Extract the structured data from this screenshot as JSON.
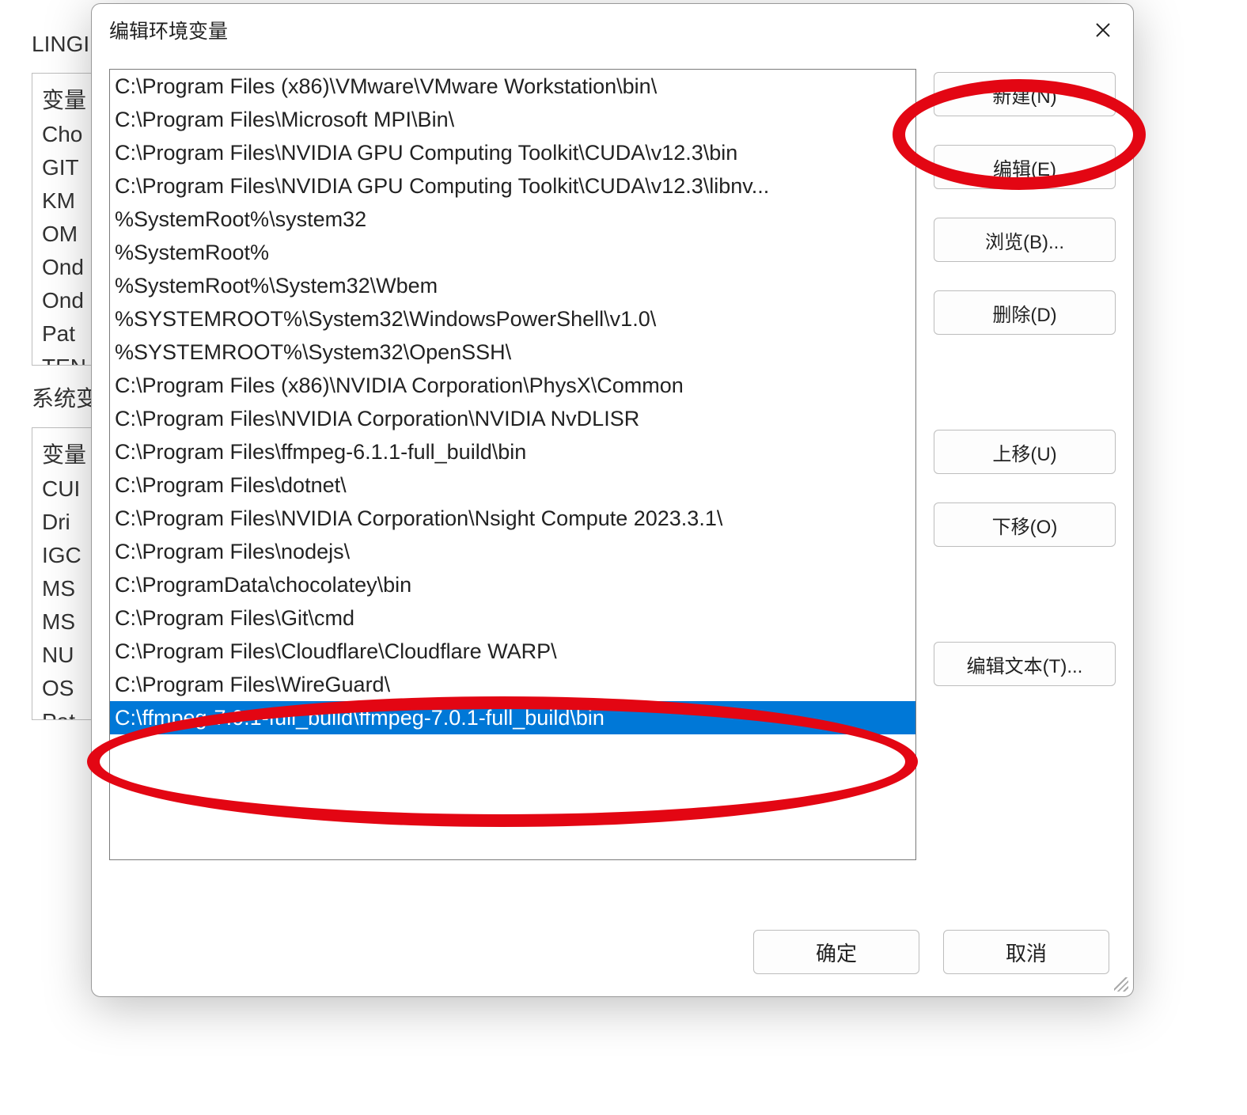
{
  "background": {
    "topLabel": "LINGI",
    "userVarsHeader": "变量",
    "userVars": [
      "Cho",
      "GIT",
      "KM",
      "OM",
      "Ond",
      "Ond",
      "Pat",
      "TEN"
    ],
    "sectionTitle": "系统变",
    "sysVarsHeader": "变量",
    "sysVars": [
      "CUI",
      "Dri",
      "IGC",
      "MS",
      "MS",
      "NU",
      "OS",
      "Pat"
    ],
    "okLabel": "确定",
    "cancelLabel": "取消"
  },
  "modal": {
    "title": "编辑环境变量",
    "paths": [
      "C:\\Program Files (x86)\\VMware\\VMware Workstation\\bin\\",
      "C:\\Program Files\\Microsoft MPI\\Bin\\",
      "C:\\Program Files\\NVIDIA GPU Computing Toolkit\\CUDA\\v12.3\\bin",
      "C:\\Program Files\\NVIDIA GPU Computing Toolkit\\CUDA\\v12.3\\libnv...",
      "%SystemRoot%\\system32",
      "%SystemRoot%",
      "%SystemRoot%\\System32\\Wbem",
      "%SYSTEMROOT%\\System32\\WindowsPowerShell\\v1.0\\",
      "%SYSTEMROOT%\\System32\\OpenSSH\\",
      "C:\\Program Files (x86)\\NVIDIA Corporation\\PhysX\\Common",
      "C:\\Program Files\\NVIDIA Corporation\\NVIDIA NvDLISR",
      "C:\\Program Files\\ffmpeg-6.1.1-full_build\\bin",
      "C:\\Program Files\\dotnet\\",
      "C:\\Program Files\\NVIDIA Corporation\\Nsight Compute 2023.3.1\\",
      "C:\\Program Files\\nodejs\\",
      "C:\\ProgramData\\chocolatey\\bin",
      "C:\\Program Files\\Git\\cmd",
      "C:\\Program Files\\Cloudflare\\Cloudflare WARP\\",
      "C:\\Program Files\\WireGuard\\",
      "C:\\ffmpeg-7.0.1-full_build\\ffmpeg-7.0.1-full_build\\bin"
    ],
    "selectedIndex": 19,
    "buttons": {
      "new": "新建(N)",
      "edit": "编辑(E)",
      "browse": "浏览(B)...",
      "delete": "删除(D)",
      "moveUp": "上移(U)",
      "moveDown": "下移(O)",
      "editText": "编辑文本(T)..."
    },
    "ok": "确定",
    "cancel": "取消"
  }
}
